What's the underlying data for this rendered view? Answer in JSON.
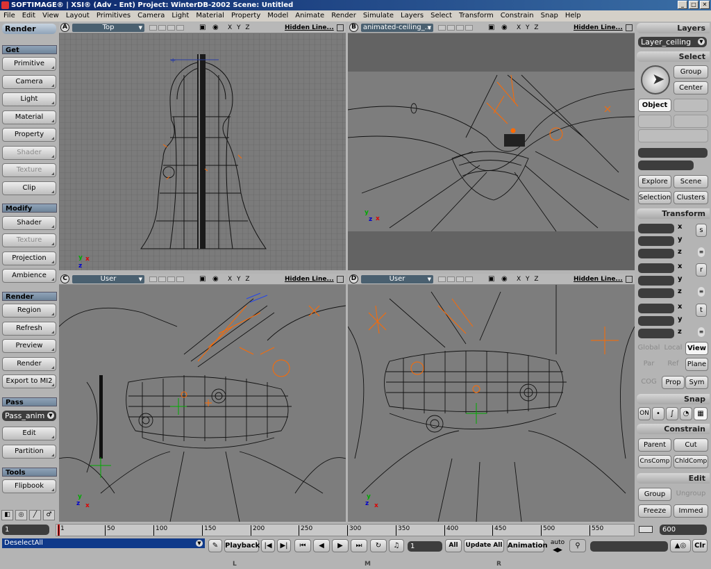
{
  "title": "SOFTIMAGE® | XSI® (Adv - Ent) Project: WinterDB-2002    Scene: Untitled",
  "window_buttons": [
    "_",
    "□",
    "✕"
  ],
  "menu": [
    "File",
    "Edit",
    "View",
    "Layout",
    "Primitives",
    "Camera",
    "Light",
    "Material",
    "Property",
    "Model",
    "Animate",
    "Render",
    "Simulate",
    "Layers",
    "Select",
    "Transform",
    "Constrain",
    "Snap",
    "Help"
  ],
  "left": {
    "module": "Render",
    "sections": {
      "get": "Get",
      "modify": "Modify",
      "render": "Render",
      "pass": "Pass",
      "tools": "Tools"
    },
    "get_buttons": [
      "Primitive",
      "Camera",
      "Light",
      "Material",
      "Property",
      "Shader",
      "Texture",
      "Clip"
    ],
    "modify_buttons": [
      "Shader",
      "Texture",
      "Projection",
      "Ambience"
    ],
    "render_buttons": [
      "Region",
      "Refresh",
      "Preview",
      "Render",
      "Export to MI2"
    ],
    "pass_dropdown": "Pass_anim",
    "pass_buttons": [
      "Edit",
      "Partition"
    ],
    "tools_buttons": [
      "Flipbook"
    ],
    "bottom_icons": [
      "◧",
      "◎",
      "╱",
      "♂"
    ]
  },
  "viewports": [
    {
      "letter": "A",
      "camera": "Top",
      "mode": "Hidden Line..."
    },
    {
      "letter": "B",
      "camera": "animated-ceiling_...",
      "mode": "Hidden Line..."
    },
    {
      "letter": "C",
      "camera": "User",
      "mode": "Hidden Line..."
    },
    {
      "letter": "D",
      "camera": "User",
      "mode": "Hidden Line..."
    }
  ],
  "viewport_axes": "X Y Z",
  "viewport_icons": {
    "camera": "camera-icon",
    "eye": "eye-icon"
  },
  "right": {
    "layers": {
      "title": "Layers",
      "current": "Layer_ceiling"
    },
    "select": {
      "title": "Select",
      "group": "Group",
      "center": "Center",
      "object": "Object",
      "explore": "Explore",
      "scene": "Scene",
      "selection": "Selection",
      "clusters": "Clusters"
    },
    "transform": {
      "title": "Transform",
      "axes": [
        "x",
        "y",
        "z"
      ],
      "tool_icons": [
        "s",
        "r",
        "t"
      ],
      "global": "Global",
      "local": "Local",
      "view": "View",
      "par": "Par",
      "ref": "Ref",
      "plane": "Plane",
      "cog": "COG",
      "prop": "Prop",
      "sym": "Sym"
    },
    "snap": {
      "title": "Snap",
      "on": "ON"
    },
    "constrain": {
      "title": "Constrain",
      "parent": "Parent",
      "cut": "Cut",
      "cnscomp": "CnsComp",
      "chldcomp": "ChldComp"
    },
    "edit": {
      "title": "Edit",
      "group": "Group",
      "ungroup": "Ungroup",
      "freeze": "Freeze",
      "immed": "Immed"
    }
  },
  "timeline": {
    "start": "1",
    "end": "600",
    "ticks": [
      "1",
      "50",
      "100",
      "150",
      "200",
      "250",
      "300",
      "350",
      "400",
      "450",
      "500",
      "550"
    ]
  },
  "bottom": {
    "command": "DeselectAll",
    "playback": "Playback",
    "current_frame": "1",
    "all": "All",
    "update_all": "Update All",
    "animation": "Animation",
    "auto": "auto",
    "clr": "Clr",
    "mouse_lmr": [
      "L",
      "M",
      "R"
    ]
  },
  "colors": {
    "title_bar": "#0a246a",
    "viewport_bg": "#7b7b7b",
    "wire": "#1a1a1a",
    "selected": "#ff6a00"
  }
}
